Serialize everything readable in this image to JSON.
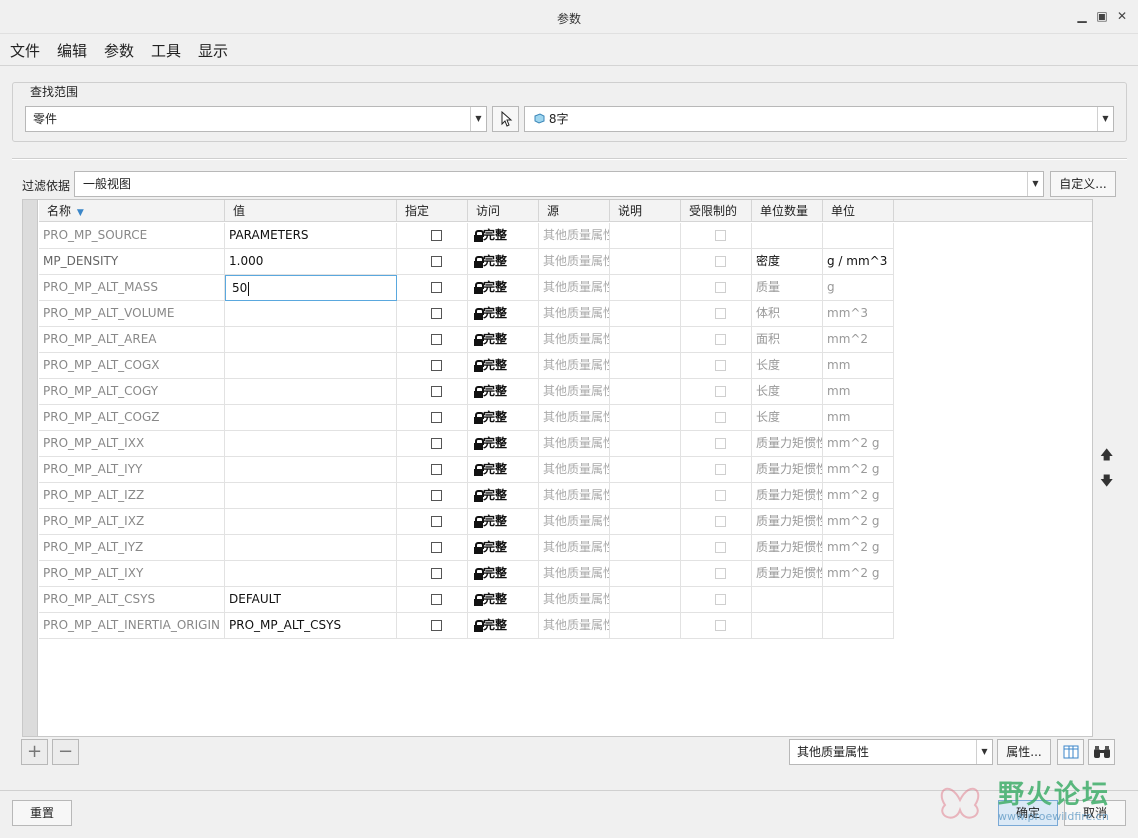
{
  "window": {
    "title": "参数"
  },
  "menu": [
    "文件",
    "编辑",
    "参数",
    "工具",
    "显示"
  ],
  "scope": {
    "legend": "查找范围",
    "type_value": "零件",
    "part_value": "8字"
  },
  "filter": {
    "label": "过滤依据",
    "value": "一般视图",
    "customize_label": "自定义..."
  },
  "table": {
    "columns": [
      "名称",
      "值",
      "指定",
      "访问",
      "源",
      "说明",
      "受限制的",
      "单位数量",
      "单位"
    ],
    "rows": [
      {
        "name": "PRO_MP_SOURCE",
        "value": "PARAMETERS",
        "access": "完整",
        "source": "其他质量属性",
        "unit_qty": "",
        "unit": ""
      },
      {
        "name": "MP_DENSITY",
        "value": "1.000",
        "access": "完整",
        "source": "其他质量属性",
        "unit_qty": "密度",
        "unit": "g / mm^3"
      },
      {
        "name": "PRO_MP_ALT_MASS",
        "value": "50",
        "access": "完整",
        "source": "其他质量属性",
        "unit_qty": "质量",
        "unit": "g"
      },
      {
        "name": "PRO_MP_ALT_VOLUME",
        "value": "",
        "access": "完整",
        "source": "其他质量属性",
        "unit_qty": "体积",
        "unit": "mm^3"
      },
      {
        "name": "PRO_MP_ALT_AREA",
        "value": "",
        "access": "完整",
        "source": "其他质量属性",
        "unit_qty": "面积",
        "unit": "mm^2"
      },
      {
        "name": "PRO_MP_ALT_COGX",
        "value": "",
        "access": "完整",
        "source": "其他质量属性",
        "unit_qty": "长度",
        "unit": "mm"
      },
      {
        "name": "PRO_MP_ALT_COGY",
        "value": "",
        "access": "完整",
        "source": "其他质量属性",
        "unit_qty": "长度",
        "unit": "mm"
      },
      {
        "name": "PRO_MP_ALT_COGZ",
        "value": "",
        "access": "完整",
        "source": "其他质量属性",
        "unit_qty": "长度",
        "unit": "mm"
      },
      {
        "name": "PRO_MP_ALT_IXX",
        "value": "",
        "access": "完整",
        "source": "其他质量属性",
        "unit_qty": "质量力矩惯性",
        "unit": "mm^2 g"
      },
      {
        "name": "PRO_MP_ALT_IYY",
        "value": "",
        "access": "完整",
        "source": "其他质量属性",
        "unit_qty": "质量力矩惯性",
        "unit": "mm^2 g"
      },
      {
        "name": "PRO_MP_ALT_IZZ",
        "value": "",
        "access": "完整",
        "source": "其他质量属性",
        "unit_qty": "质量力矩惯性",
        "unit": "mm^2 g"
      },
      {
        "name": "PRO_MP_ALT_IXZ",
        "value": "",
        "access": "完整",
        "source": "其他质量属性",
        "unit_qty": "质量力矩惯性",
        "unit": "mm^2 g"
      },
      {
        "name": "PRO_MP_ALT_IYZ",
        "value": "",
        "access": "完整",
        "source": "其他质量属性",
        "unit_qty": "质量力矩惯性",
        "unit": "mm^2 g"
      },
      {
        "name": "PRO_MP_ALT_IXY",
        "value": "",
        "access": "完整",
        "source": "其他质量属性",
        "unit_qty": "质量力矩惯性",
        "unit": "mm^2 g"
      },
      {
        "name": "PRO_MP_ALT_CSYS",
        "value": "DEFAULT",
        "access": "完整",
        "source": "其他质量属性",
        "unit_qty": "",
        "unit": ""
      },
      {
        "name": "PRO_MP_ALT_INERTIA_ORIGIN",
        "value": "PRO_MP_ALT_CSYS",
        "access": "完整",
        "source": "其他质量属性",
        "unit_qty": "",
        "unit": ""
      }
    ]
  },
  "bottom": {
    "source_filter": "其他质量属性",
    "properties_label": "属性...",
    "reset_label": "重置",
    "ok_label": "确定",
    "cancel_label": "取消"
  },
  "watermark": {
    "text": "野火论坛",
    "url": "www.proewildfire.cn"
  }
}
